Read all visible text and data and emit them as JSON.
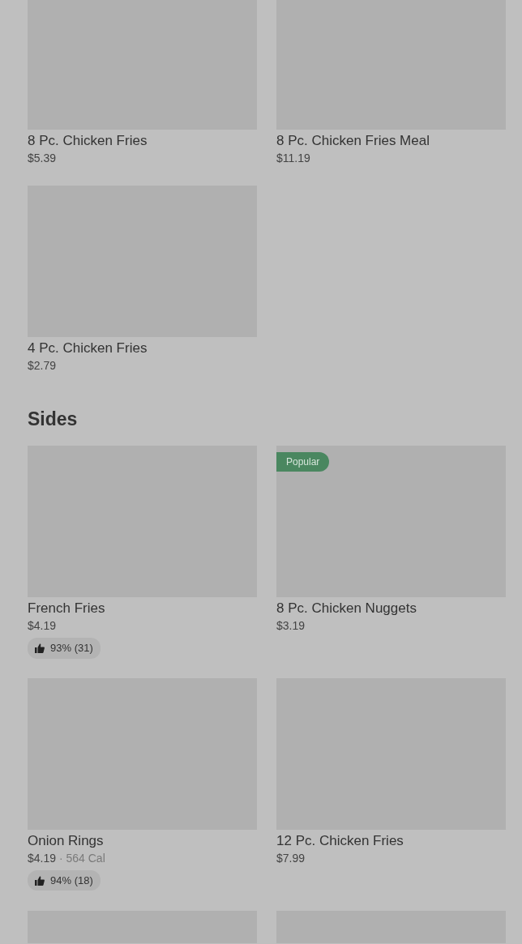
{
  "sections": [
    {
      "rows": [
        [
          {
            "kind": "item",
            "name": "8 Pc. Chicken Fries",
            "price": "$5.39"
          },
          {
            "kind": "item",
            "name": "8 Pc. Chicken Fries Meal",
            "price": "$11.19"
          }
        ],
        [
          {
            "kind": "item",
            "name": "4 Pc. Chicken Fries",
            "price": "$2.79"
          }
        ]
      ]
    },
    {
      "title": "Sides",
      "rows": [
        [
          {
            "kind": "item",
            "name": "French Fries",
            "price": "$4.19",
            "rating": "93% (31)"
          },
          {
            "kind": "item",
            "name": "8 Pc. Chicken Nuggets",
            "price": "$3.19",
            "badge": "Popular"
          }
        ],
        [
          {
            "kind": "item",
            "name": "Onion Rings",
            "price": "$4.19",
            "separator": "·",
            "calories": "564 Cal",
            "rating": "94% (18)"
          },
          {
            "kind": "item",
            "name": "12 Pc. Chicken Fries",
            "price": "$7.99"
          }
        ],
        [
          {
            "kind": "cut"
          },
          {
            "kind": "cut"
          }
        ]
      ]
    }
  ]
}
